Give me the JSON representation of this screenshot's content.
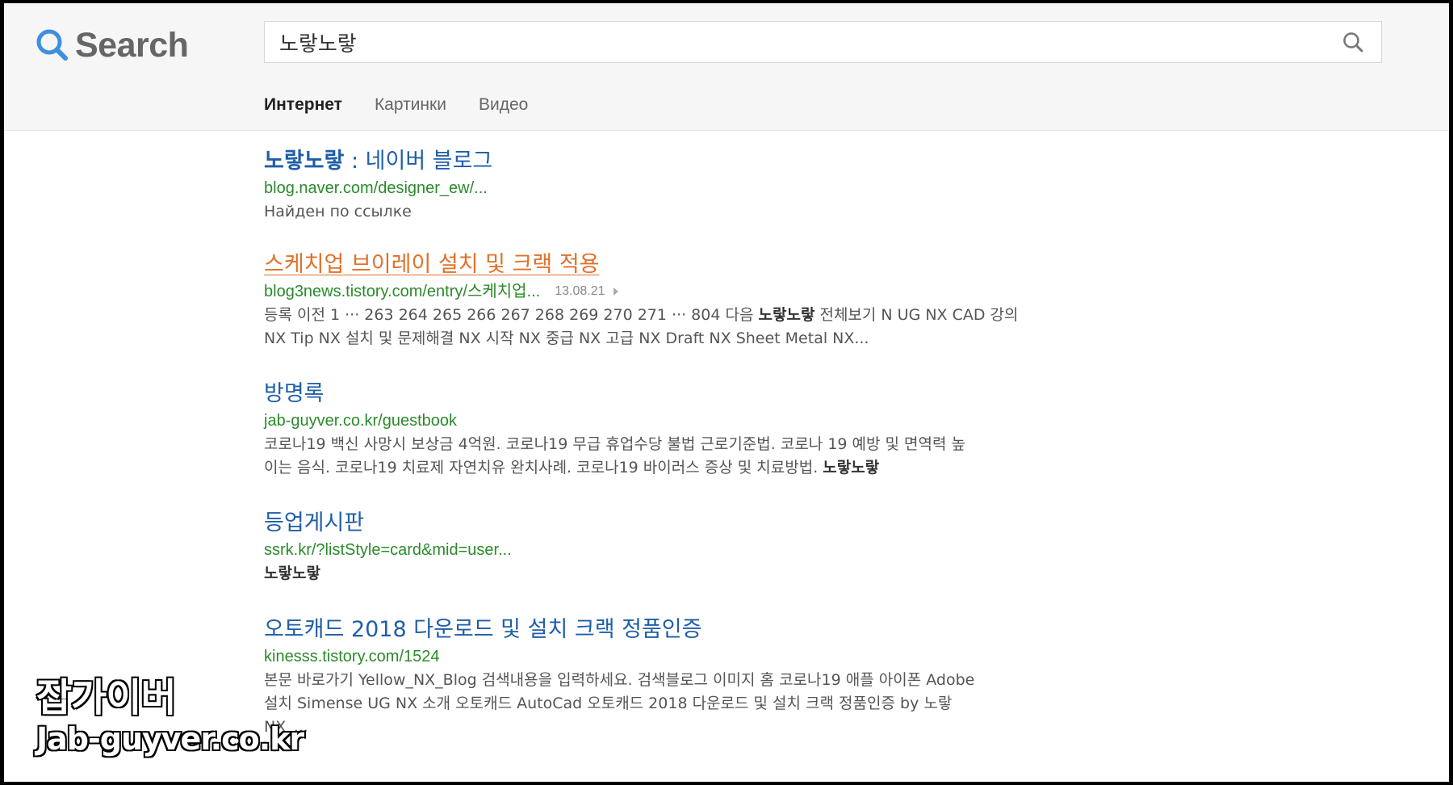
{
  "logo": {
    "text": "Search",
    "icon": "magnifier-icon",
    "icon_color": "#3d8fe0"
  },
  "search": {
    "query": "노랗노랗",
    "button_icon": "search-icon"
  },
  "tabs": [
    {
      "label": "Интернет",
      "active": true
    },
    {
      "label": "Картинки",
      "active": false
    },
    {
      "label": "Видео",
      "active": false
    }
  ],
  "results": [
    {
      "title_bold": "노랗노랗",
      "title_rest": " : 네이버 블로그",
      "url": "blog.naver.com/designer_ew/...",
      "snippet": "Найден по ссылке"
    },
    {
      "title": "스케치업 브이레이 설치 및 크랙 적용",
      "visited": true,
      "url": "blog3news.tistory.com/entry/스케치업...",
      "date": "13.08.21",
      "snippet_line1_pre": "등록 이전 1 ··· 263 264 265 266 267 268 269 270 271 ··· 804 다음 ",
      "snippet_line1_bold": "노랗노랗",
      "snippet_line1_post": " 전체보기 N UG NX CAD 강의",
      "snippet_line2": "NX Tip NX 설치 및 문제해결 NX 시작 NX 중급 NX 고급 NX Draft NX Sheet Metal NX..."
    },
    {
      "title": "방명록",
      "url": "jab-guyver.co.kr/guestbook",
      "snippet_line1": "코로나19 백신 사망시 보상금 4억원. 코로나19 무급 휴업수당 불법 근로기준법. 코로나 19 예방 및 면역력 높",
      "snippet_line2_pre": "이는 음식. 코로나19 치료제 자연치유 완치사례. 코로나19 바이러스 증상 및 치료방법. ",
      "snippet_line2_bold": "노랗노랗"
    },
    {
      "title": "등업게시판",
      "url": "ssrk.kr/?listStyle=card&mid=user...",
      "snippet_bold": "노랗노랗"
    },
    {
      "title": "오토캐드 2018 다운로드 및 설치 크랙 정품인증",
      "url": "kinesss.tistory.com/1524",
      "snippet_line1": "본문 바로가기 Yellow_NX_Blog 검색내용을 입력하세요. 검색블로그 이미지 홈 코로나19 애플 아이폰 Adobe",
      "snippet_line2": "설치 Simense UG NX 소개 오토캐드 AutoCad 오토캐드 2018 다운로드 및 설치 크랙 정품인증 by 노랗",
      "snippet_line3": "NX_..."
    }
  ],
  "watermark": {
    "line1": "잡가이버",
    "line2": "Jab-guyver.co.kr"
  },
  "colors": {
    "link": "#1f5ea8",
    "visited": "#e2702a",
    "url": "#2b8a2b"
  }
}
